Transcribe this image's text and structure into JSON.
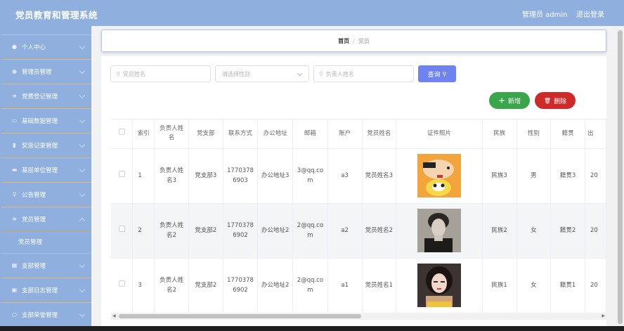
{
  "header": {
    "title": "党员教育和管理系统",
    "user": "管理员 admin",
    "logout": "退出登录"
  },
  "sidebar": {
    "items": [
      {
        "label": "个人中心",
        "icon": "user-icon"
      },
      {
        "label": "管理员管理",
        "icon": "circle-icon"
      },
      {
        "label": "党费登记管理",
        "icon": "list-icon"
      },
      {
        "label": "基础数据管理",
        "icon": "message-icon"
      },
      {
        "label": "奖惩记录管理",
        "icon": "chart-icon"
      },
      {
        "label": "基层单位管理",
        "icon": "briefcase-icon"
      },
      {
        "label": "公告管理",
        "icon": "mic-icon"
      },
      {
        "label": "党员管理",
        "icon": "list-icon"
      },
      {
        "label": "支部管理",
        "icon": "grid-icon"
      },
      {
        "label": "支部日志管理",
        "icon": "picture-icon"
      },
      {
        "label": "支部荣誉管理",
        "icon": "circle-icon"
      }
    ],
    "sub_item": "党员管理"
  },
  "breadcrumb": {
    "home": "首页",
    "sep": "/",
    "current": "党员"
  },
  "search": {
    "name_placeholder": "党员姓名",
    "gender_placeholder": "请选择性别",
    "leader_placeholder": "负责人姓名",
    "query_label": "查询"
  },
  "actions": {
    "add_label": "新增",
    "delete_label": "删除"
  },
  "table": {
    "headers": [
      "索引",
      "负责人姓名",
      "党支部",
      "联系方式",
      "办公地址",
      "邮箱",
      "账户",
      "党员姓名",
      "证件照片",
      "民族",
      "性别",
      "籍贯",
      "出"
    ],
    "rows": [
      {
        "idx": "1",
        "leader": "负责人姓名3",
        "branch": "党支部3",
        "phone": "17703786903",
        "office": "办公地址3",
        "email": "3@qq.com",
        "account": "a3",
        "member": "党员姓名3",
        "ethnic": "民族3",
        "gender": "男",
        "native": "籍贯3",
        "birth": "20"
      },
      {
        "idx": "2",
        "leader": "负责人姓名2",
        "branch": "党支部2",
        "phone": "17703786902",
        "office": "办公地址2",
        "email": "2@qq.com",
        "account": "a2",
        "member": "党员姓名2",
        "ethnic": "民族2",
        "gender": "女",
        "native": "籍贯2",
        "birth": "20"
      },
      {
        "idx": "3",
        "leader": "负责人姓名2",
        "branch": "党支部2",
        "phone": "17703786902",
        "office": "办公地址2",
        "email": "2@qq.com",
        "account": "a1",
        "member": "党员姓名1",
        "ethnic": "民族1",
        "gender": "女",
        "native": "籍贯1",
        "birth": "20"
      }
    ]
  },
  "colors": {
    "header": "#8fb0de",
    "query": "#6f83f0",
    "add": "#3aa54a",
    "delete": "#cf2a2a"
  }
}
